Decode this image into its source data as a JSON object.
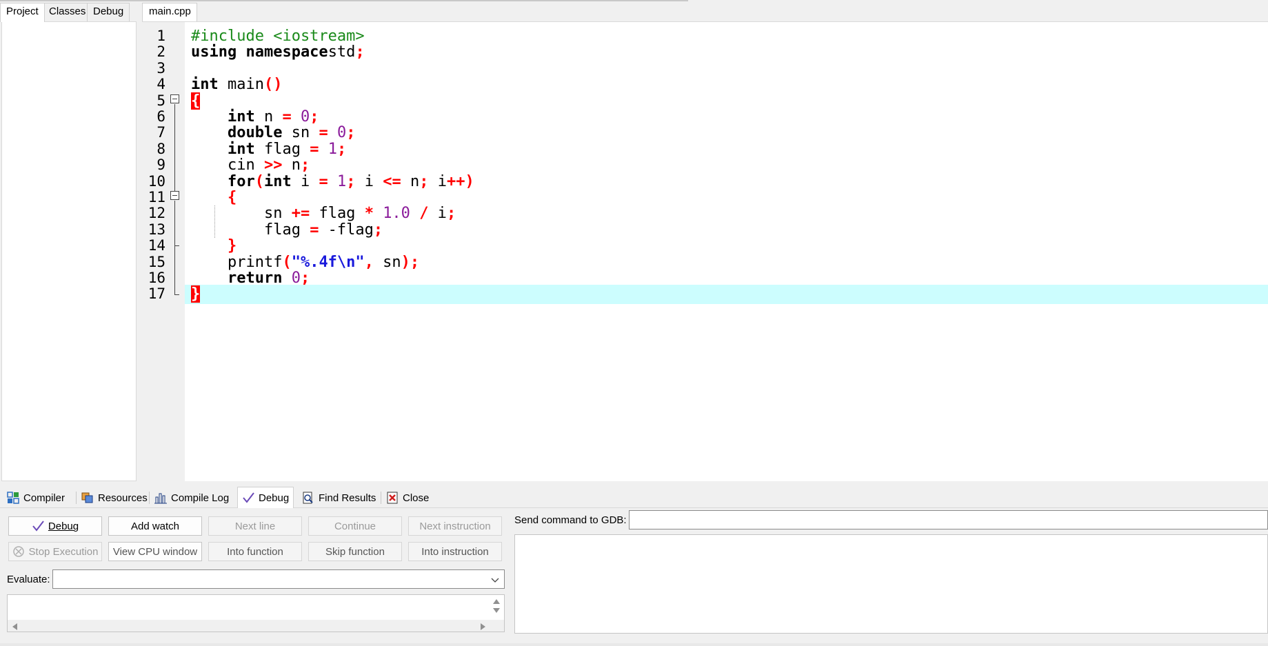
{
  "left_panel": {
    "tabs": [
      {
        "label": "Project",
        "active": true
      },
      {
        "label": "Classes",
        "active": false
      },
      {
        "label": "Debug",
        "active": false
      }
    ]
  },
  "editor": {
    "tab_label": "main.cpp",
    "current_line": 17,
    "line_numbers": [
      "1",
      "2",
      "3",
      "4",
      "5",
      "6",
      "7",
      "8",
      "9",
      "10",
      "11",
      "12",
      "13",
      "14",
      "15",
      "16",
      "17"
    ]
  },
  "bottom_tabs": [
    {
      "label": "Compiler",
      "icon": "compiler-grid-icon",
      "active": false
    },
    {
      "label": "Resources",
      "icon": "resources-icon",
      "active": false
    },
    {
      "label": "Compile Log",
      "icon": "compile-log-chart-icon",
      "active": false
    },
    {
      "label": "Debug",
      "icon": "debug-check-icon",
      "active": true
    },
    {
      "label": "Find Results",
      "icon": "find-results-icon",
      "active": false
    },
    {
      "label": "Close",
      "icon": "close-icon",
      "active": false
    }
  ],
  "debug": {
    "buttons_row1": [
      "Debug",
      "Add watch",
      "Next line",
      "Continue",
      "Next instruction"
    ],
    "buttons_row2": [
      "Stop Execution",
      "View CPU window",
      "Into function",
      "Skip function",
      "Into instruction"
    ],
    "evaluate_label": "Evaluate:",
    "evaluate_value": "",
    "gdb_label": "Send command to GDB:",
    "gdb_value": ""
  },
  "colors": {
    "keyword": "#000000",
    "preprocessor": "#1a8a1a",
    "number": "#8a1a9a",
    "operator": "#ff0000",
    "string": "#1a1adc",
    "current_line_bg": "#ccfdfe",
    "brace_highlight": "#ff0000"
  }
}
